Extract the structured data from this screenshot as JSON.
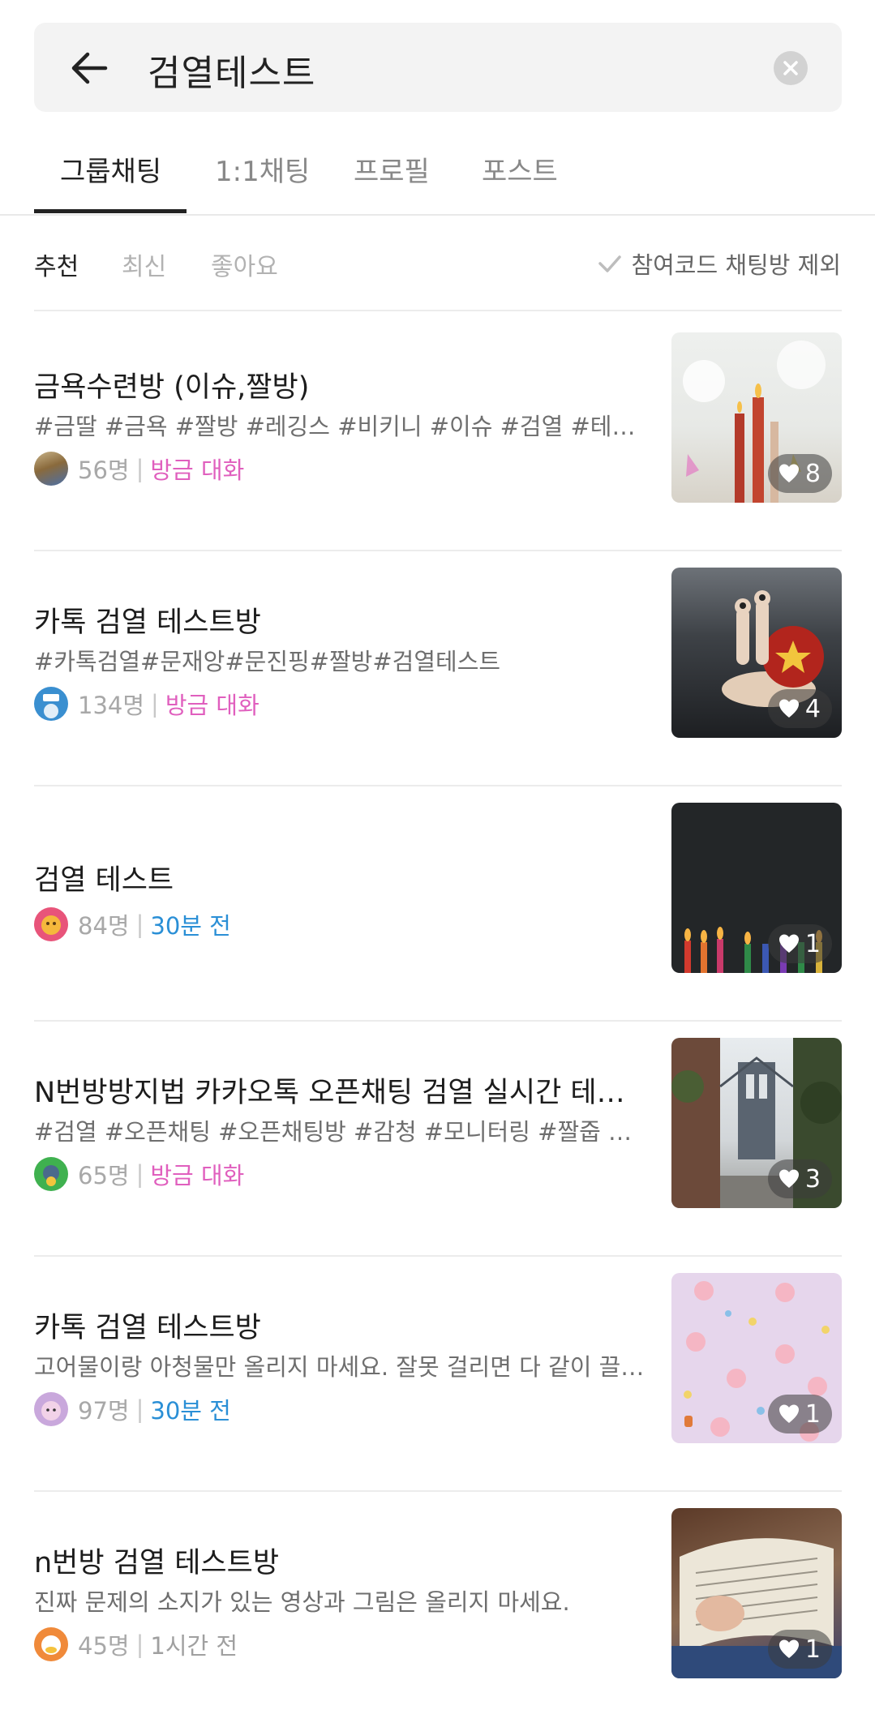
{
  "search": {
    "query": "검열테스트"
  },
  "tabs": [
    {
      "label": "그룹채팅",
      "active": true
    },
    {
      "label": "1:1채팅",
      "active": false
    },
    {
      "label": "프로필",
      "active": false
    },
    {
      "label": "포스트",
      "active": false
    }
  ],
  "sort": {
    "options": [
      {
        "label": "추천",
        "active": true
      },
      {
        "label": "최신",
        "active": false
      },
      {
        "label": "좋아요",
        "active": false
      }
    ],
    "exclude_label": "참여코드 채팅방 제외"
  },
  "rooms": [
    {
      "title": "금욕수련방 (이슈,짤방)",
      "description": "#금딸 #금욕 #짤방 #레깅스 #비키니 #이슈 #검열 #테스트 #야짤",
      "members": "56명",
      "activity": "방금 대화",
      "activity_color": "#e05fbe",
      "likes": "8"
    },
    {
      "title": "카톡 검열 테스트방",
      "description": "#카톡검열#문재앙#문진핑#짤방#검열테스트",
      "members": "134명",
      "activity": "방금 대화",
      "activity_color": "#e05fbe",
      "likes": "4"
    },
    {
      "title": "검열 테스트",
      "description": "",
      "members": "84명",
      "activity": "30분 전",
      "activity_color": "#2a8fd6",
      "likes": "1"
    },
    {
      "title": "N번방방지법 카카오톡 오픈채팅 검열 실시간 테스트방",
      "description": "#검열 #오픈채팅 #오픈채팅방 #감청 #모니터링 #짤줍 #움짤",
      "members": "65명",
      "activity": "방금 대화",
      "activity_color": "#e05fbe",
      "likes": "3"
    },
    {
      "title": "카톡 검열 테스트방",
      "description": "고어물이랑 아청물만 올리지 마세요. 잘못 걸리면 다 같이 끌려가요",
      "members": "97명",
      "activity": "30분 전",
      "activity_color": "#2a8fd6",
      "likes": "1"
    },
    {
      "title": "n번방 검열 테스트방",
      "description": "진짜 문제의 소지가 있는 영상과 그림은 올리지 마세요.",
      "members": "45명",
      "activity": "1시간 전",
      "activity_color": "#a0a0a0",
      "likes": "1"
    }
  ]
}
